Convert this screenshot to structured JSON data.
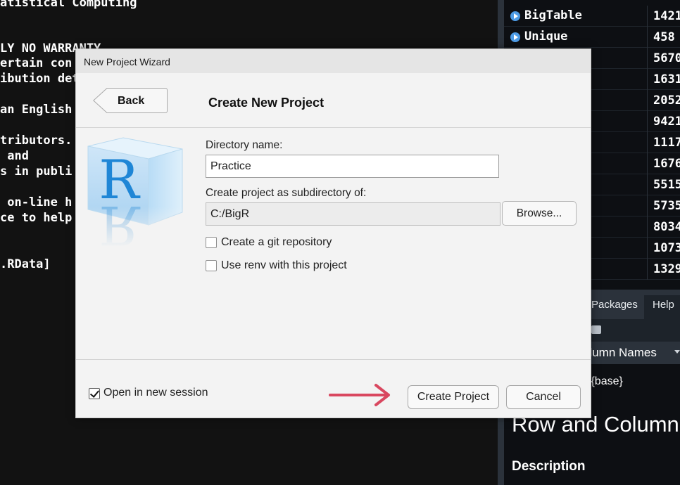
{
  "console": {
    "lines": [
      "atistical Computing",
      "LY NO WARRANTY.",
      "ertain con",
      "ibution det",
      "an English",
      "tributors.",
      " and",
      "s in publi",
      " on-line h",
      "ce to help",
      ".RData]"
    ]
  },
  "environment": {
    "rows": [
      {
        "name": "BigTable",
        "value": "1421"
      },
      {
        "name": "Unique",
        "value": "458"
      },
      {
        "name": "",
        "value": "5670"
      },
      {
        "name": "",
        "value": "1631"
      },
      {
        "name": "",
        "value": "2052"
      },
      {
        "name": "",
        "value": "9421"
      },
      {
        "name": "",
        "value": "1117"
      },
      {
        "name": "",
        "value": "1676"
      },
      {
        "name": "",
        "value": "5515"
      },
      {
        "name": "",
        "value": "5735"
      },
      {
        "name": "",
        "value": "8034"
      },
      {
        "name": "",
        "value": "1073"
      },
      {
        "name": "",
        "value": "1329"
      }
    ]
  },
  "help_panel": {
    "tabs": [
      "Packages",
      "Help"
    ],
    "topic_bar": "olumn Names",
    "package": "s {base}",
    "heading": "Row and Column",
    "section": "Description"
  },
  "dialog": {
    "window_title": "New Project Wizard",
    "back_label": "Back",
    "page_title": "Create New Project",
    "logo_letter": "R",
    "directory_label": "Directory name:",
    "directory_value": "Practice",
    "parent_label": "Create project as subdirectory of:",
    "parent_value": "C:/BigR",
    "browse_label": "Browse...",
    "git_label": "Create a git repository",
    "git_checked": false,
    "renv_label": "Use renv with this project",
    "renv_checked": false,
    "open_session_label": "Open in new session",
    "open_session_checked": true,
    "create_label": "Create Project",
    "cancel_label": "Cancel",
    "arrow_color": "#d9475f"
  }
}
